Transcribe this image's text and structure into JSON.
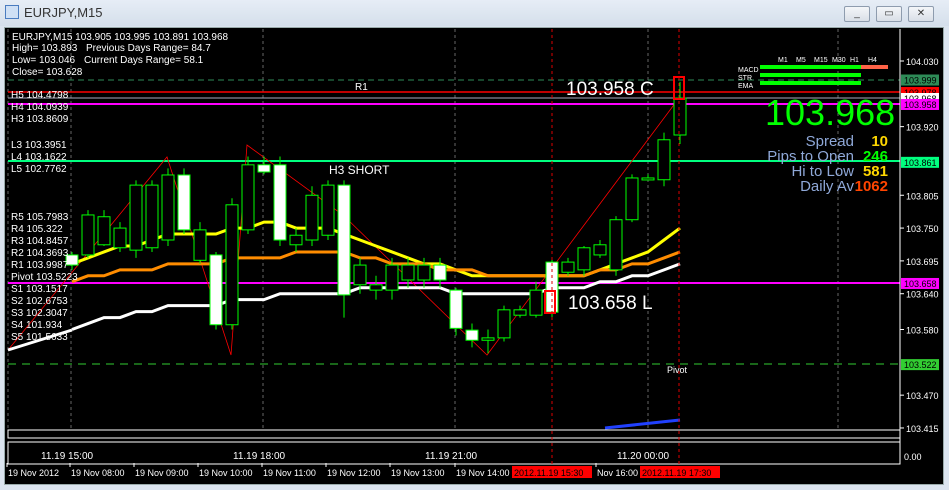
{
  "window": {
    "title": "EURJPY,M15",
    "min": "_",
    "restore": "▭",
    "close": "✕"
  },
  "info": {
    "line1": "EURJPY,M15  103.905 103.995 103.891 103.968",
    "high": "High= 103.893",
    "prev_range": "Previous Days Range= 84.7",
    "low": "Low= 103.046",
    "cur_range": "Current Days Range= 58.1",
    "close": "Close= 103.628"
  },
  "levels_left": [
    "H5 104.4798",
    "H4 104.0939",
    "H3 103.8609",
    "L3 103.3951",
    "L4 103.1622",
    "L5 102.7762"
  ],
  "pivots_left": [
    "R5 105.7983",
    "R4 105.322",
    "R3 104.8457",
    "R2 104.3693",
    "R1 103.9987",
    "Pivot 103.5223",
    "S1 103.1517",
    "S2 102.6753",
    "S3 102.3047",
    "S4 101.934",
    "S5 101.5633"
  ],
  "labels": {
    "r1": "R1",
    "h3short": "H3 SHORT",
    "pivot": "Pivot",
    "high_mark": "103.958 C",
    "low_mark": "103.658 L"
  },
  "panel": {
    "timeframes": [
      "M1",
      "M5",
      "M15",
      "M30",
      "H1",
      "H4"
    ],
    "rows": [
      "MACD",
      "STR",
      "EMA"
    ],
    "price": "103.968",
    "spread_label": "Spread",
    "spread": "10",
    "pto_label": "Pips to Open",
    "pto": "246",
    "hl_label": "Hi to Low",
    "hl": "581",
    "da_label": "Daily Av",
    "da": "1062"
  },
  "price_axis": [
    "104.030",
    "103.920",
    "103.805",
    "103.750",
    "103.695",
    "103.640",
    "103.580",
    "103.470",
    "103.415"
  ],
  "price_tags": [
    {
      "v": "103.999",
      "bg": "#2e8b57",
      "y": 103.999
    },
    {
      "v": "103.978",
      "bg": "#ff0000",
      "y": 103.978
    },
    {
      "v": "103.968",
      "bg": "#ffffff",
      "y": 103.968
    },
    {
      "v": "103.958",
      "bg": "#ff00ff",
      "y": 103.958
    },
    {
      "v": "103.861",
      "bg": "#00ff7f",
      "y": 103.861
    },
    {
      "v": "103.658",
      "bg": "#ff00ff",
      "y": 103.658
    },
    {
      "v": "103.522",
      "bg": "#32cd32",
      "y": 103.522
    }
  ],
  "sub_axis": "0.00",
  "sub_times": [
    "11.19 15:00",
    "11.19 18:00",
    "11.19 21:00",
    "11.20 00:00"
  ],
  "time_axis": [
    "19 Nov 2012",
    "19 Nov 08:00",
    "19 Nov 09:00",
    "19 Nov 10:00",
    "19 Nov 11:00",
    "19 Nov 12:00",
    "19 Nov 13:00",
    "19 Nov 14:00",
    "2012.11.19 15:30",
    "Nov 16:00",
    "2012.11.19 17:30"
  ],
  "colors": {
    "bull": "#00ff00",
    "bear": "#ffffff",
    "yellow": "#ffff00",
    "orange": "#ff8c00",
    "white": "#ffffff",
    "magenta": "#ff00ff",
    "red": "#ff0000",
    "green_line": "#00ff7f"
  },
  "chart_data": {
    "type": "candlestick",
    "symbol": "EURJPY",
    "timeframe": "M15",
    "ylim": [
      103.4,
      104.05
    ],
    "candles": [
      [
        103.705,
        103.688,
        103.71,
        103.68
      ],
      [
        103.705,
        103.772,
        103.78,
        103.7
      ],
      [
        103.722,
        103.769,
        103.78,
        103.72
      ],
      [
        103.717,
        103.75,
        103.76,
        103.71
      ],
      [
        103.713,
        103.822,
        103.83,
        103.7
      ],
      [
        103.717,
        103.822,
        103.83,
        103.71
      ],
      [
        103.73,
        103.839,
        103.85,
        103.72
      ],
      [
        103.839,
        103.747,
        103.85,
        103.74
      ],
      [
        103.696,
        103.747,
        103.76,
        103.69
      ],
      [
        103.705,
        103.588,
        103.71,
        103.58
      ],
      [
        103.588,
        103.789,
        103.8,
        103.58
      ],
      [
        103.747,
        103.856,
        103.87,
        103.74
      ],
      [
        103.856,
        103.844,
        103.87,
        103.84
      ],
      [
        103.856,
        103.73,
        103.87,
        103.72
      ],
      [
        103.722,
        103.738,
        103.75,
        103.71
      ],
      [
        103.73,
        103.805,
        103.82,
        103.72
      ],
      [
        103.738,
        103.822,
        103.83,
        103.73
      ],
      [
        103.822,
        103.638,
        103.83,
        103.6
      ],
      [
        103.655,
        103.688,
        103.7,
        103.64
      ],
      [
        103.646,
        103.655,
        103.67,
        103.63
      ],
      [
        103.646,
        103.688,
        103.7,
        103.63
      ],
      [
        103.663,
        103.688,
        103.7,
        103.65
      ],
      [
        103.663,
        103.688,
        103.7,
        103.65
      ],
      [
        103.688,
        103.663,
        103.7,
        103.65
      ],
      [
        103.646,
        103.582,
        103.65,
        103.57
      ],
      [
        103.579,
        103.562,
        103.59,
        103.55
      ],
      [
        103.562,
        103.566,
        103.58,
        103.54
      ],
      [
        103.566,
        103.613,
        103.62,
        103.56
      ],
      [
        103.604,
        103.613,
        103.62,
        103.6
      ],
      [
        103.604,
        103.646,
        103.66,
        103.6
      ],
      [
        103.693,
        103.609,
        103.7,
        103.6
      ],
      [
        103.676,
        103.693,
        103.7,
        103.67
      ],
      [
        103.68,
        103.717,
        103.72,
        103.67
      ],
      [
        103.705,
        103.722,
        103.73,
        103.7
      ],
      [
        103.68,
        103.764,
        103.77,
        103.67
      ],
      [
        103.764,
        103.834,
        103.84,
        103.76
      ],
      [
        103.831,
        103.834,
        103.84,
        103.83
      ],
      [
        103.831,
        103.898,
        103.91,
        103.82
      ],
      [
        103.906,
        103.968,
        103.995,
        103.891
      ]
    ],
    "ma_yellow": [
      103.69,
      103.7,
      103.71,
      103.72,
      103.72,
      103.73,
      103.74,
      103.74,
      103.74,
      103.74,
      103.75,
      103.75,
      103.76,
      103.76,
      103.75,
      103.75,
      103.75,
      103.74,
      103.73,
      103.72,
      103.71,
      103.7,
      103.69,
      103.69,
      103.68,
      103.67,
      103.67,
      103.67,
      103.67,
      103.67,
      103.67,
      103.67,
      103.67,
      103.68,
      103.69,
      103.7,
      103.71,
      103.73,
      103.75
    ],
    "ma_orange": [
      103.66,
      103.67,
      103.67,
      103.68,
      103.68,
      103.68,
      103.69,
      103.69,
      103.69,
      103.69,
      103.7,
      103.7,
      103.7,
      103.7,
      103.71,
      103.71,
      103.71,
      103.71,
      103.7,
      103.7,
      103.69,
      103.69,
      103.69,
      103.68,
      103.68,
      103.68,
      103.67,
      103.67,
      103.67,
      103.67,
      103.67,
      103.67,
      103.67,
      103.68,
      103.68,
      103.69,
      103.69,
      103.7,
      103.71
    ],
    "ma_white": [
      103.58,
      103.59,
      103.6,
      103.6,
      103.61,
      103.61,
      103.62,
      103.62,
      103.62,
      103.62,
      103.63,
      103.63,
      103.63,
      103.64,
      103.64,
      103.64,
      103.64,
      103.64,
      103.65,
      103.65,
      103.65,
      103.65,
      103.65,
      103.65,
      103.64,
      103.64,
      103.64,
      103.64,
      103.64,
      103.64,
      103.65,
      103.65,
      103.65,
      103.66,
      103.66,
      103.67,
      103.67,
      103.68,
      103.69
    ]
  }
}
